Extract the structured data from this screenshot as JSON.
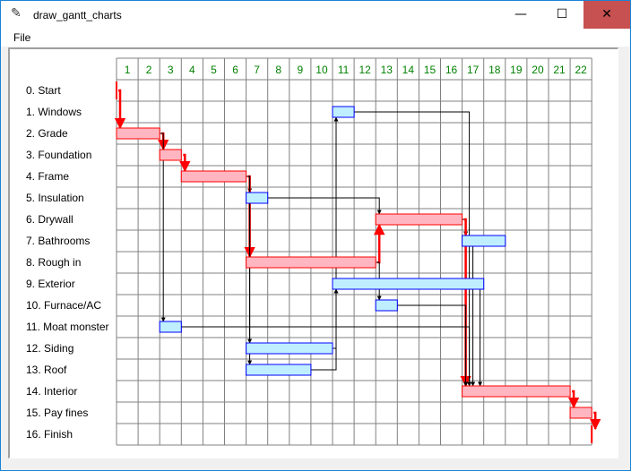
{
  "window": {
    "title": "draw_gantt_charts",
    "icon": "feather-icon",
    "minimize_glyph": "—",
    "maximize_glyph": "☐",
    "close_glyph": "✕"
  },
  "menu": {
    "items": [
      "File"
    ]
  },
  "chart_data": {
    "type": "gantt",
    "days": [
      1,
      2,
      3,
      4,
      5,
      6,
      7,
      8,
      9,
      10,
      11,
      12,
      13,
      14,
      15,
      16,
      17,
      18,
      19,
      20,
      21,
      22
    ],
    "tasks": [
      {
        "label": "0. Start",
        "start": 1,
        "duration": 0,
        "critical": true
      },
      {
        "label": "1. Windows",
        "start": 11,
        "duration": 1,
        "critical": false
      },
      {
        "label": "2. Grade",
        "start": 1,
        "duration": 2,
        "critical": true
      },
      {
        "label": "3. Foundation",
        "start": 3,
        "duration": 1,
        "critical": true
      },
      {
        "label": "4. Frame",
        "start": 4,
        "duration": 3,
        "critical": true
      },
      {
        "label": "5. Insulation",
        "start": 7,
        "duration": 1,
        "critical": false
      },
      {
        "label": "6. Drywall",
        "start": 13,
        "duration": 4,
        "critical": true
      },
      {
        "label": "7. Bathrooms",
        "start": 17,
        "duration": 2,
        "critical": false
      },
      {
        "label": "8. Rough in",
        "start": 7,
        "duration": 6,
        "critical": true
      },
      {
        "label": "9. Exterior",
        "start": 11,
        "duration": 7,
        "critical": false
      },
      {
        "label": "10. Furnace/AC",
        "start": 13,
        "duration": 1,
        "critical": false
      },
      {
        "label": "11. Moat monster",
        "start": 3,
        "duration": 1,
        "critical": false
      },
      {
        "label": "12. Siding",
        "start": 7,
        "duration": 4,
        "critical": false
      },
      {
        "label": "13. Roof",
        "start": 7,
        "duration": 3,
        "critical": false
      },
      {
        "label": "14. Interior",
        "start": 17,
        "duration": 5,
        "critical": true
      },
      {
        "label": "15. Pay fines",
        "start": 22,
        "duration": 1,
        "critical": true
      },
      {
        "label": "16. Finish",
        "start": 23,
        "duration": 0,
        "critical": true
      }
    ],
    "links": [
      {
        "from": 0,
        "to": 2,
        "critical": true
      },
      {
        "from": 2,
        "to": 3,
        "critical": true
      },
      {
        "from": 2,
        "to": 11,
        "critical": false
      },
      {
        "from": 3,
        "to": 4,
        "critical": true
      },
      {
        "from": 4,
        "to": 5,
        "critical": false
      },
      {
        "from": 4,
        "to": 8,
        "critical": true
      },
      {
        "from": 4,
        "to": 12,
        "critical": false
      },
      {
        "from": 4,
        "to": 13,
        "critical": false
      },
      {
        "from": 12,
        "to": 1,
        "critical": false
      },
      {
        "from": 12,
        "to": 9,
        "critical": false
      },
      {
        "from": 13,
        "to": 9,
        "critical": false
      },
      {
        "from": 5,
        "to": 6,
        "critical": false
      },
      {
        "from": 8,
        "to": 6,
        "critical": true
      },
      {
        "from": 8,
        "to": 10,
        "critical": false
      },
      {
        "from": 6,
        "to": 7,
        "critical": false
      },
      {
        "from": 6,
        "to": 14,
        "critical": true
      },
      {
        "from": 1,
        "to": 14,
        "critical": false
      },
      {
        "from": 7,
        "to": 14,
        "critical": false
      },
      {
        "from": 9,
        "to": 14,
        "critical": false
      },
      {
        "from": 10,
        "to": 14,
        "critical": false
      },
      {
        "from": 11,
        "to": 14,
        "critical": false
      },
      {
        "from": 14,
        "to": 15,
        "critical": true
      },
      {
        "from": 15,
        "to": 16,
        "critical": true
      }
    ],
    "colors": {
      "critical_fill": "#ffb6c1",
      "critical_line": "#ff0000",
      "normal_fill": "#bfefff",
      "normal_line": "#000000",
      "bar_outline_normal": "#0000ff",
      "bar_outline_critical": "#ff0000",
      "grid": "#808080",
      "day_labels": "#008000"
    }
  }
}
